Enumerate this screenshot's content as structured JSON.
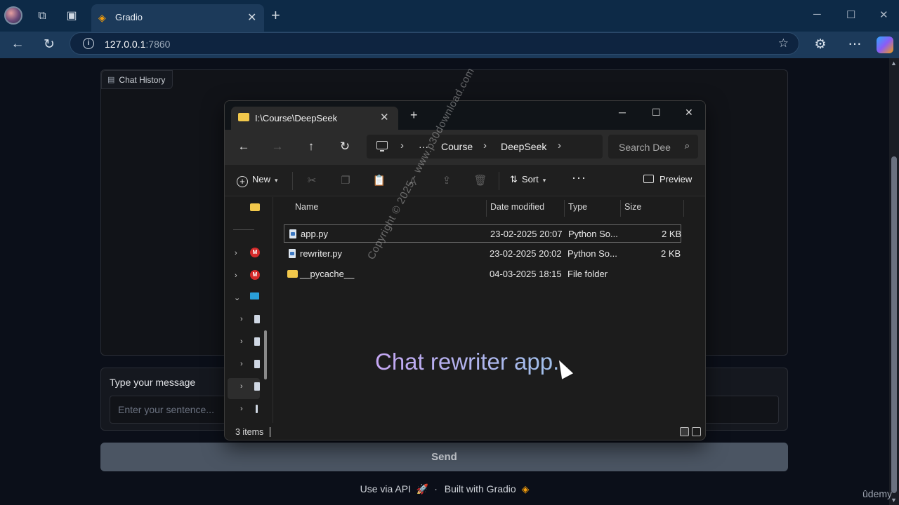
{
  "browser": {
    "tab_title": "Gradio",
    "url_host": "127.0.0.1",
    "url_port": ":7860",
    "icons": {
      "workspaces": "workspaces-icon",
      "tab_actions": "tab-actions-icon",
      "favicon": "gradio-favicon-icon",
      "close": "close-icon",
      "new_tab": "plus-icon",
      "back": "back-arrow-icon",
      "refresh": "refresh-icon",
      "info": "info-icon",
      "favorite": "star-icon",
      "extensions": "extensions-icon",
      "menu": "more-icon",
      "copilot": "copilot-icon"
    }
  },
  "gradio": {
    "chat_label": "Chat History",
    "message_label": "Type your message",
    "message_placeholder": "Enter your sentence...",
    "send_label": "Send",
    "footer_api": "Use via API",
    "footer_sep": "·",
    "footer_built": "Built with Gradio"
  },
  "explorer": {
    "tab_title": "I:\\Course\\DeepSeek",
    "breadcrumbs": [
      "Course",
      "DeepSeek"
    ],
    "breadcrumb_overflow": "···",
    "search_placeholder": "Search Dee",
    "commands": {
      "new": "New",
      "sort": "Sort",
      "more": "···",
      "preview": "Preview"
    },
    "columns": [
      "Name",
      "Date modified",
      "Type",
      "Size"
    ],
    "files": [
      {
        "name": "app.py",
        "date": "23-02-2025 20:07",
        "type": "Python So...",
        "size": "2 KB",
        "kind": "python",
        "selected": true
      },
      {
        "name": "rewriter.py",
        "date": "23-02-2025 20:02",
        "type": "Python So...",
        "size": "2 KB",
        "kind": "python",
        "selected": false
      },
      {
        "name": "__pycache__",
        "date": "04-03-2025 18:15",
        "type": "File folder",
        "size": "",
        "kind": "folder",
        "selected": false
      }
    ],
    "status": "3 items"
  },
  "overlay": {
    "caption": "Chat rewriter app.",
    "watermark": "Copyright © 2025 - www.p30download.com"
  },
  "brand": {
    "udemy": "ûdemy"
  },
  "colors": {
    "browser_chrome": "#0d2a47",
    "gradio_bg": "#0b0f19",
    "send_button": "#4b5563",
    "folder": "#f2c84b",
    "gradio_accent": "#f59e0b"
  }
}
